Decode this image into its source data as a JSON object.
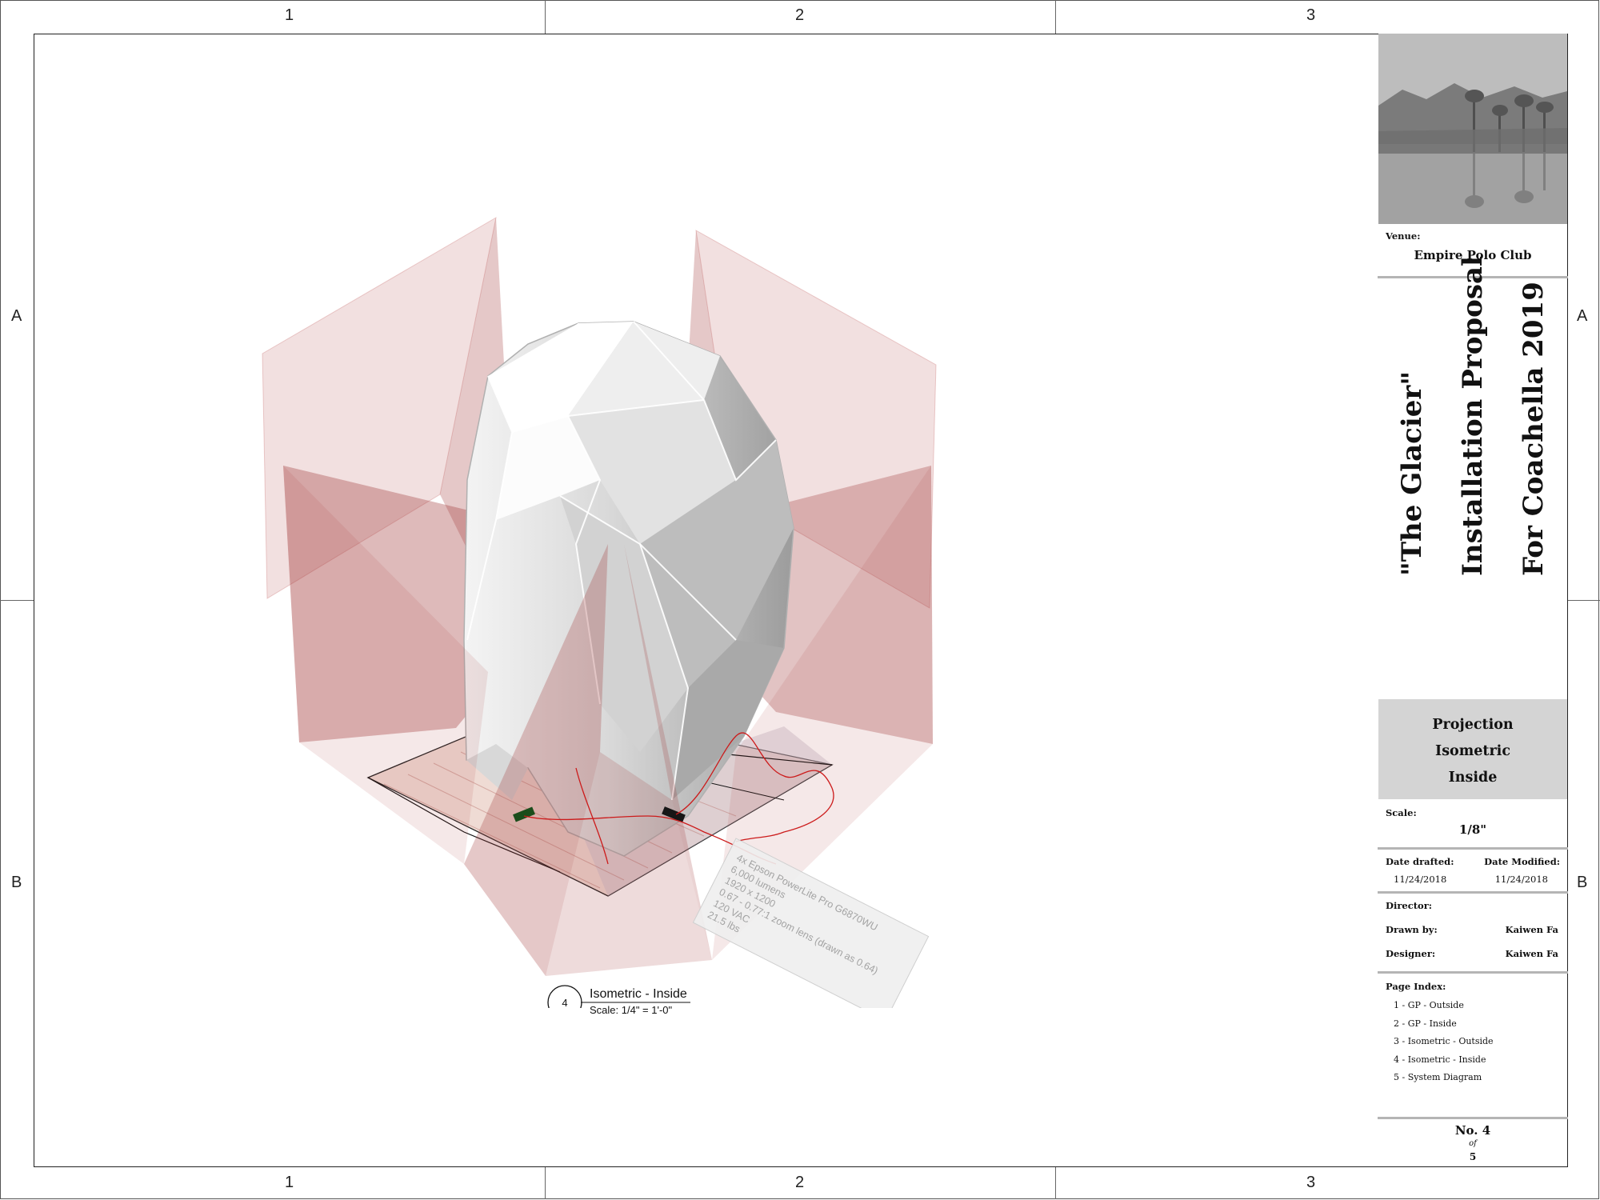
{
  "grid": {
    "columns": [
      "1",
      "2",
      "3"
    ],
    "rows": [
      "A",
      "B"
    ]
  },
  "drawing": {
    "view_number": "4",
    "view_title": "Isometric - Inside",
    "view_scale": "Scale: 1/4\" = 1'-0\"",
    "projector_note": {
      "lines": [
        "4x Epson PowerLite Pro G6870WU",
        "6,000 lumens",
        "1920 x 1200",
        "0.67 - 0.77:1 zoom lens (drawn as 0.64)",
        "120 VAC",
        "21.5 lbs"
      ]
    },
    "colors": {
      "projection_volume": "#b04040",
      "sculpture": "#e9e9e9",
      "cable": "#cc1b1b"
    }
  },
  "title_block": {
    "venue_label": "Venue:",
    "venue_name": "Empire Polo Club",
    "title_lines": [
      "\"The Glacier\"",
      "Installation Proposal",
      "For Coachella 2019"
    ],
    "sheet_name_lines": [
      "Projection",
      "Isometric",
      "Inside"
    ],
    "scale_label": "Scale:",
    "scale_value": "1/8\"",
    "date_drafted_label": "Date drafted:",
    "date_drafted": "11/24/2018",
    "date_modified_label": "Date Modified:",
    "date_modified": "11/24/2018",
    "director_label": "Director:",
    "director": "",
    "drawn_by_label": "Drawn by:",
    "drawn_by": "Kaiwen Fa",
    "designer_label": "Designer:",
    "designer": "Kaiwen Fa",
    "page_index_label": "Page Index:",
    "page_index": [
      "1 - GP - Outside",
      "2 - GP - Inside",
      "3 - Isometric - Outside",
      "4 - Isometric - Inside",
      "5 - System Diagram"
    ],
    "sheet_no": "No. 4",
    "sheet_of": "of",
    "sheet_total": "5"
  }
}
